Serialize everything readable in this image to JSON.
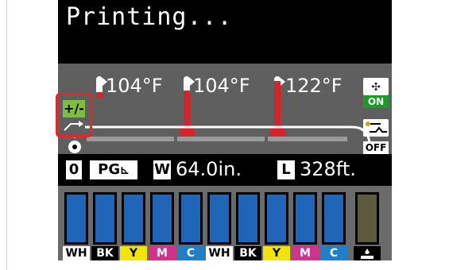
{
  "screen": {
    "title": "Printing...",
    "temperatures": [
      "104°F",
      "104°F",
      "122°F"
    ],
    "fan": {
      "state": "ON",
      "icon": "fan-icon"
    },
    "takeup": {
      "state": "OFF",
      "icon": "takeup-reel-icon"
    },
    "adjust_icon_text": "+/-",
    "info": {
      "counter": "0",
      "page_label": "PG",
      "width_label": "W",
      "width_value": "64.0in.",
      "length_label": "L",
      "length_value": "328ft."
    },
    "inks": [
      {
        "label": "WH",
        "label_bg": "#ffffff",
        "label_color": "#000000"
      },
      {
        "label": "BK",
        "label_bg": "#000000",
        "label_color": "#ffffff"
      },
      {
        "label": "Y",
        "label_bg": "#f2e600",
        "label_color": "#000000"
      },
      {
        "label": "M",
        "label_bg": "#d6308f",
        "label_color": "#ffffff"
      },
      {
        "label": "C",
        "label_bg": "#1f7fc8",
        "label_color": "#ffffff"
      },
      {
        "label": "WH",
        "label_bg": "#ffffff",
        "label_color": "#000000"
      },
      {
        "label": "BK",
        "label_bg": "#000000",
        "label_color": "#ffffff"
      },
      {
        "label": "Y",
        "label_bg": "#f2e600",
        "label_color": "#000000"
      },
      {
        "label": "M",
        "label_bg": "#d6308f",
        "label_color": "#ffffff"
      },
      {
        "label": "C",
        "label_bg": "#1f7fc8",
        "label_color": "#ffffff"
      }
    ],
    "waste_ink_icon": "waste-ink-icon",
    "colors": {
      "cartridge": "#1f66b9",
      "waste": "#5b5a3a",
      "highlight": "#e3282d",
      "on_green": "#1c9a2a"
    }
  }
}
